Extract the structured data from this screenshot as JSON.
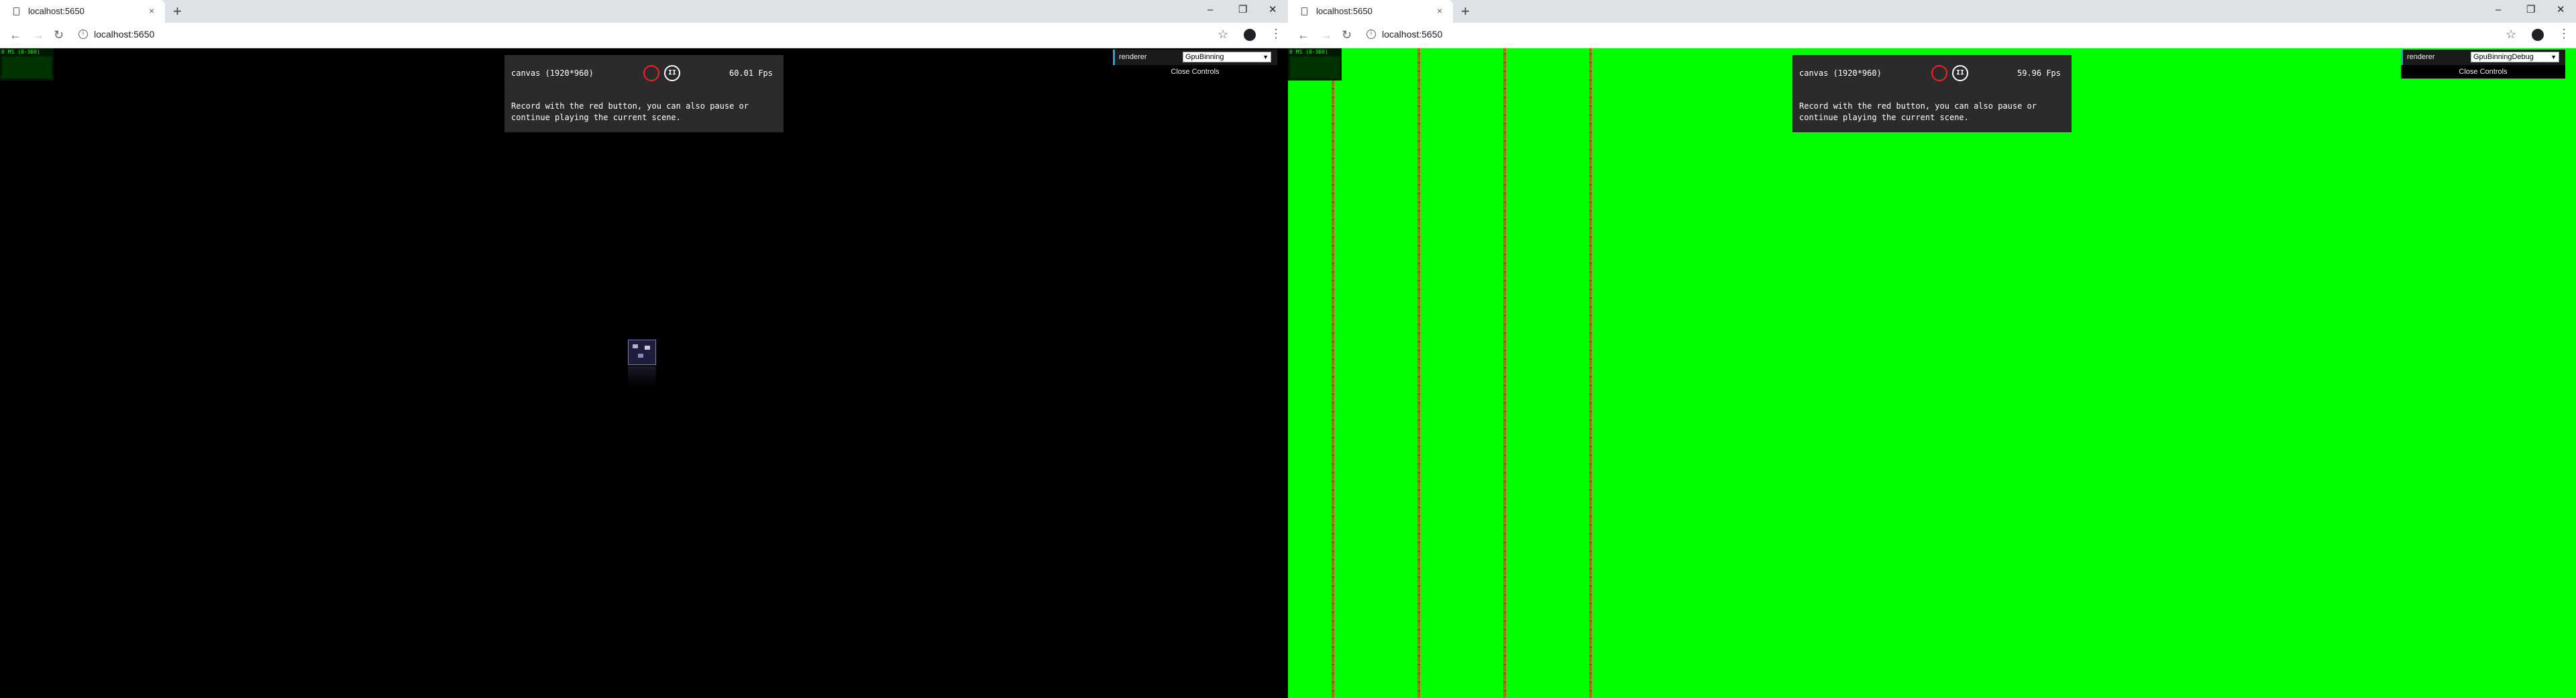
{
  "windows": [
    {
      "tab": {
        "title": "localhost:5650",
        "close": "×"
      },
      "new_tab": "+",
      "controls": {
        "minimize": "–",
        "restore": "❐",
        "close": "✕"
      },
      "nav": {
        "back": "←",
        "forward": "→",
        "reload": "↻"
      },
      "url": "localhost:5650",
      "stats": {
        "text": "0 MS (0-300)"
      },
      "panel": {
        "canvas_label": "canvas (1920*960)",
        "fps": "60.01 Fps",
        "description": "Record with the red button, you can also pause or continue playing the current scene."
      },
      "gui": {
        "label": "renderer",
        "value": "GpuBinning",
        "close": "Close Controls"
      },
      "viewport_color": "#000000"
    },
    {
      "tab": {
        "title": "localhost:5650",
        "close": "×"
      },
      "new_tab": "+",
      "controls": {
        "minimize": "–",
        "restore": "❐",
        "close": "✕"
      },
      "nav": {
        "back": "←",
        "forward": "→",
        "reload": "↻"
      },
      "url": "localhost:5650",
      "stats": {
        "text": "0 MS (0-300)"
      },
      "panel": {
        "canvas_label": "canvas (1920*960)",
        "fps": "59.96 Fps",
        "description": "Record with the red button, you can also pause or continue playing the current scene."
      },
      "gui": {
        "label": "renderer",
        "value": "GpuBinningDebug",
        "close": "Close Controls"
      },
      "viewport_color": "#00ff00"
    }
  ],
  "icons": {
    "pause": "II",
    "star": "☆",
    "menu": "⋮",
    "info": "i",
    "select_arrow": "▼"
  },
  "colors": {
    "record": "#ff2020",
    "debug_background": "#00ff00",
    "debug_lines": "#ff3030",
    "gui_accent": "#2fa1d6"
  }
}
